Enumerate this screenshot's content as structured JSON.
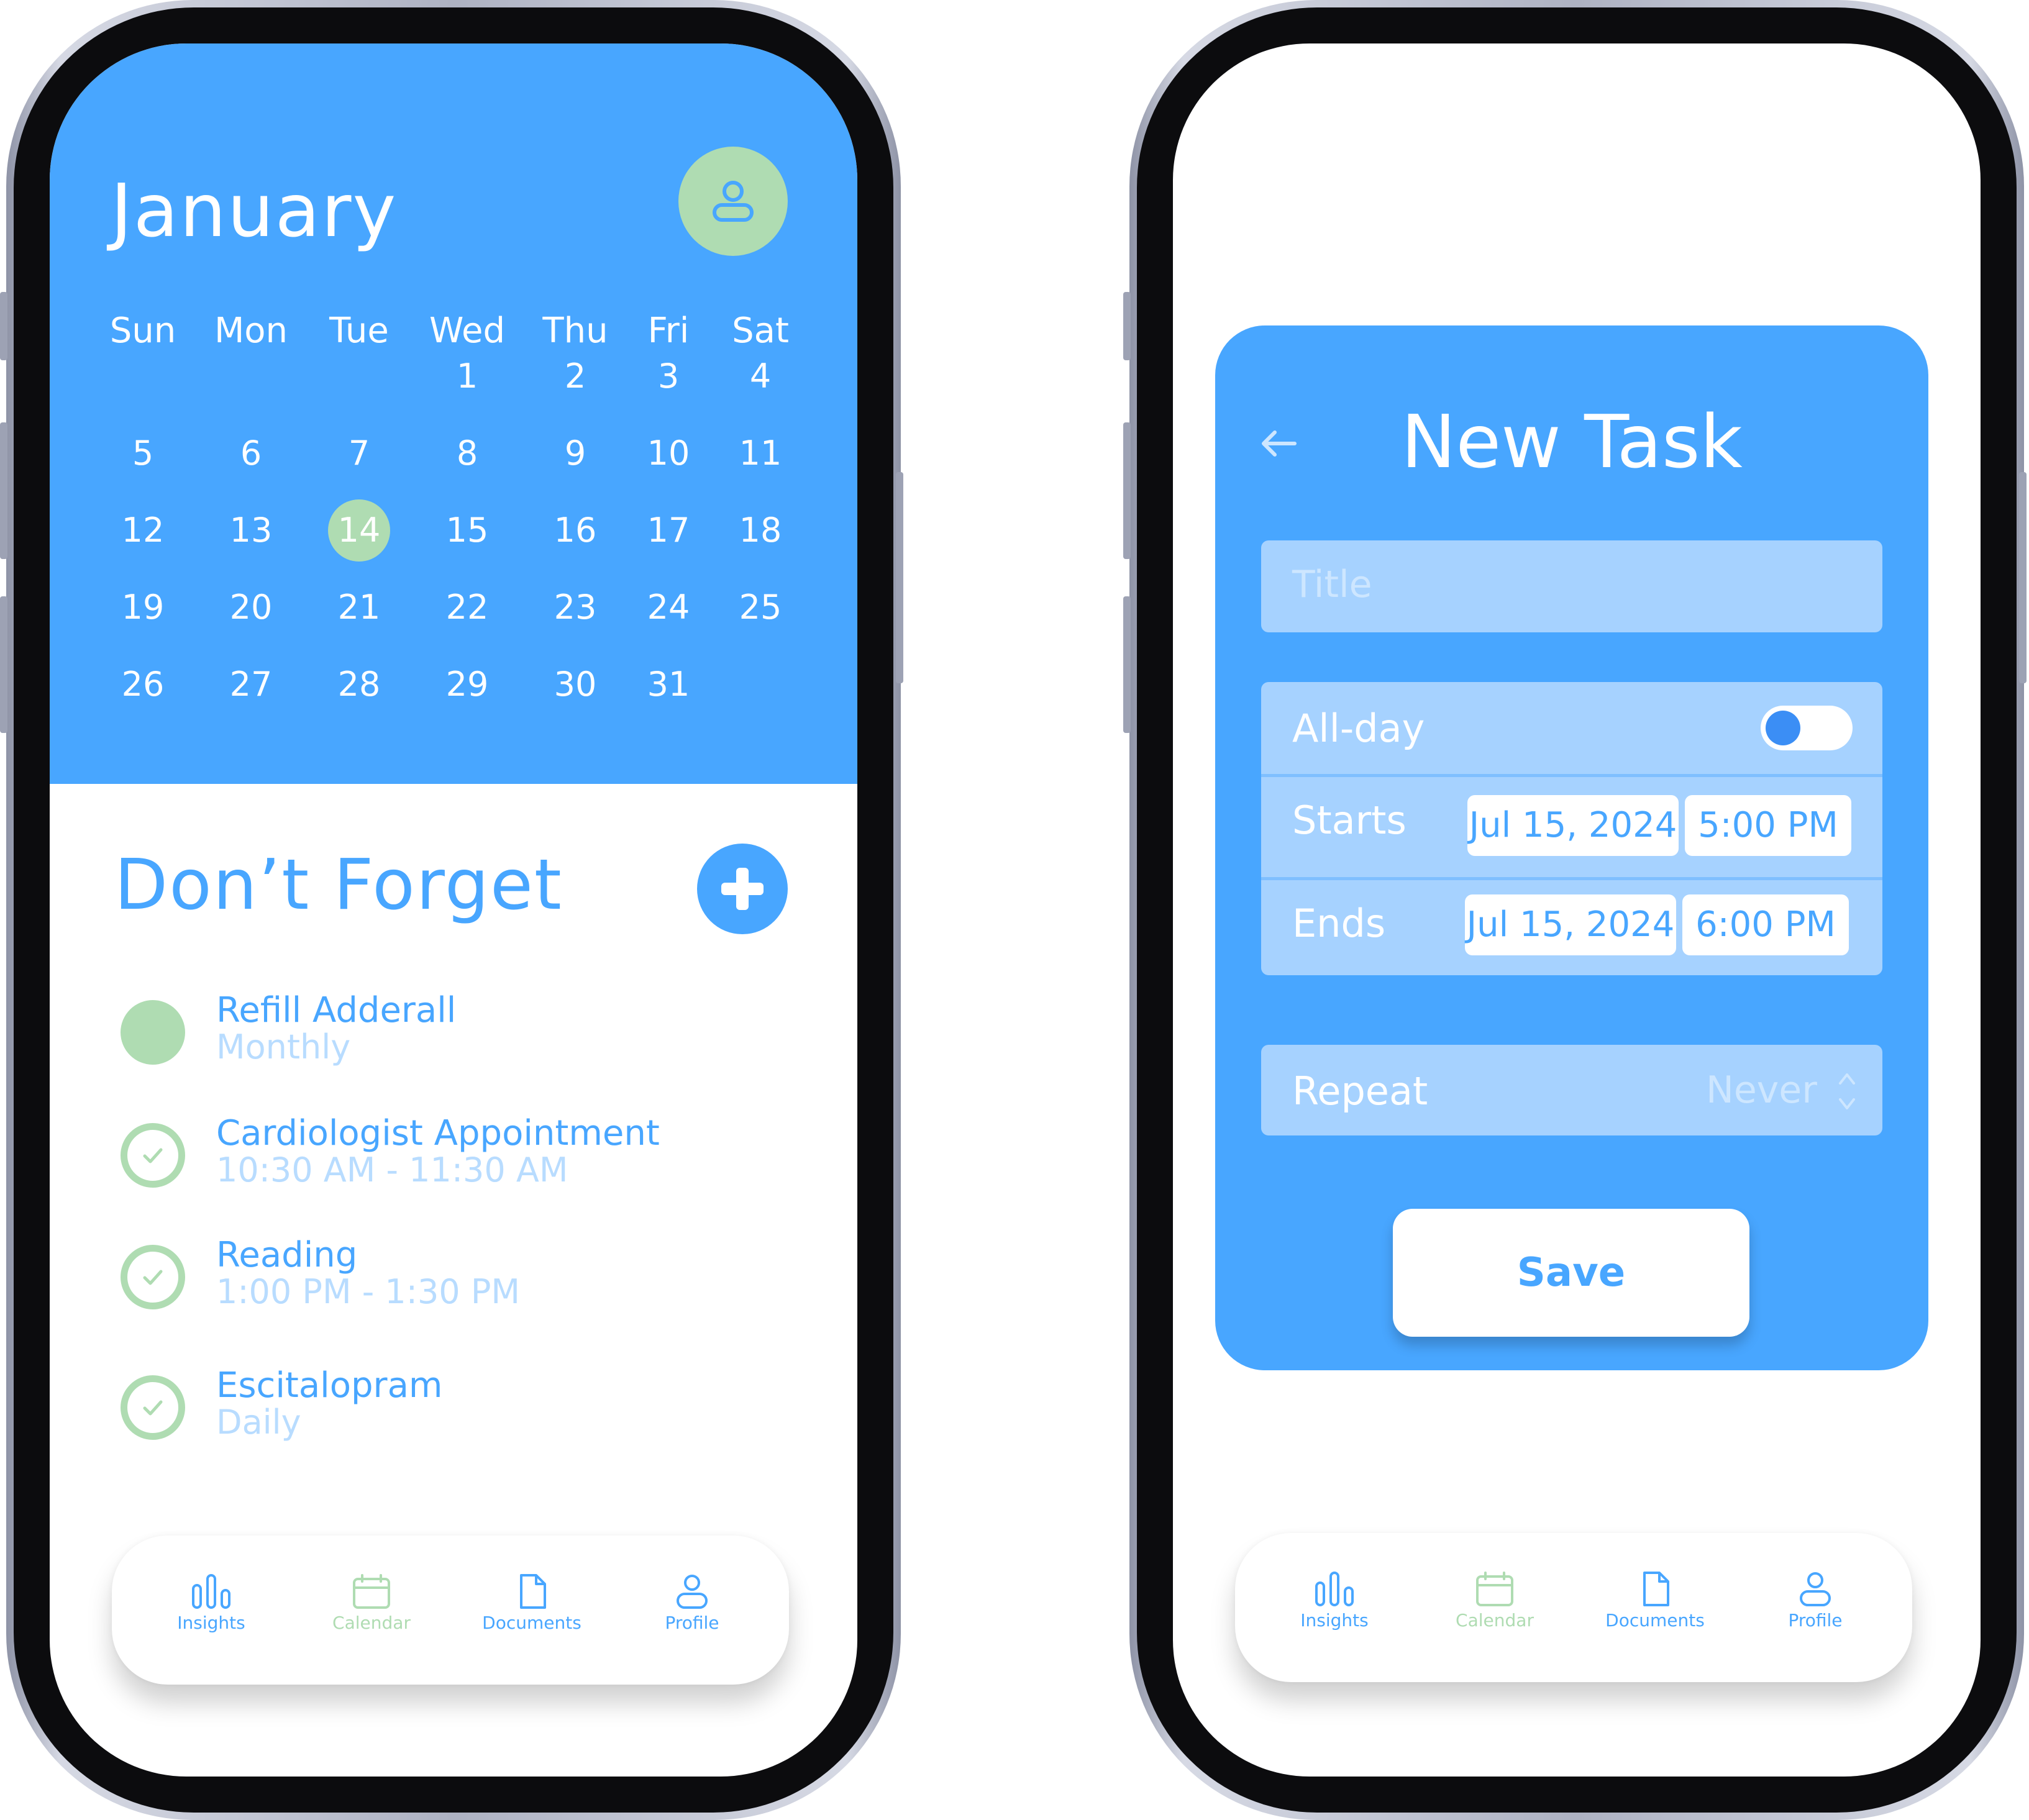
{
  "calendar": {
    "month": "January",
    "weekdays": [
      "Sun",
      "Mon",
      "Tue",
      "Wed",
      "Thu",
      "Fri",
      "Sat"
    ],
    "weeks": [
      [
        "",
        "",
        "",
        "1",
        "2",
        "3",
        "4"
      ],
      [
        "5",
        "6",
        "7",
        "8",
        "9",
        "10",
        "11"
      ],
      [
        "12",
        "13",
        "14",
        "15",
        "16",
        "17",
        "18"
      ],
      [
        "19",
        "20",
        "21",
        "22",
        "23",
        "24",
        "25"
      ],
      [
        "26",
        "27",
        "28",
        "29",
        "30",
        "31",
        ""
      ]
    ],
    "selected_day": "14"
  },
  "dont_forget": {
    "title": "Don’t Forget",
    "tasks": [
      {
        "title": "Refill Adderall",
        "subtitle": "Monthly",
        "completed": false
      },
      {
        "title": "Cardiologist Appointment",
        "subtitle": "10:30 AM - 11:30 AM",
        "completed": true
      },
      {
        "title": "Reading",
        "subtitle": "1:00 PM - 1:30 PM",
        "completed": true
      },
      {
        "title": "Escitalopram",
        "subtitle": "Daily",
        "completed": true
      }
    ]
  },
  "tabbar": {
    "tabs": [
      {
        "label": "Insights",
        "icon": "bar-chart-icon",
        "active": false
      },
      {
        "label": "Calendar",
        "icon": "calendar-icon",
        "active": true
      },
      {
        "label": "Documents",
        "icon": "document-icon",
        "active": false
      },
      {
        "label": "Profile",
        "icon": "user-icon",
        "active": false
      }
    ]
  },
  "new_task": {
    "title": "New Task",
    "title_placeholder": "Title",
    "allday_label": "All-day",
    "allday_on": false,
    "starts_label": "Starts",
    "starts_date": "Jul 15, 2024",
    "starts_time": "5:00 PM",
    "ends_label": "Ends",
    "ends_date": "Jul 15, 2024",
    "ends_time": "6:00 PM",
    "repeat_label": "Repeat",
    "repeat_value": "Never",
    "save_label": "Save"
  },
  "colors": {
    "primary_blue": "#48a6ff",
    "light_blue": "#a6d2ff",
    "pale_text_blue": "#b8dcff",
    "accent_green": "#afdcb2",
    "toggle_knob": "#3b8ef5"
  }
}
